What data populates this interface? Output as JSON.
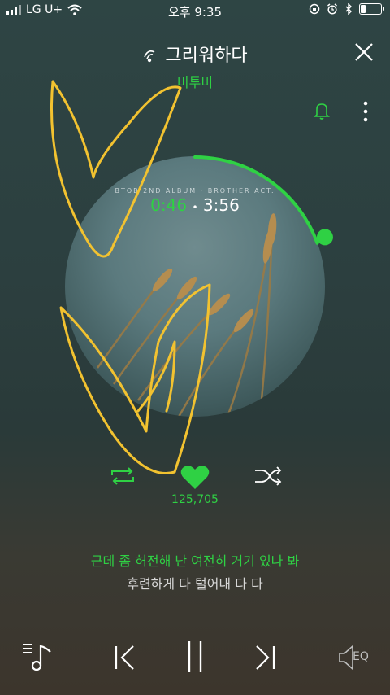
{
  "status_bar": {
    "carrier": "LG U+",
    "time": "오후 9:35",
    "battery_level": 0.25
  },
  "song": {
    "title": "그리워하다",
    "artist": "비투비"
  },
  "album": {
    "label": "BTOB 2ND ALBUM · BROTHER ACT."
  },
  "playback": {
    "current": "0:46",
    "separator": "•",
    "total": "3:56",
    "progress": 0.195
  },
  "likes": "125,705",
  "lyrics": {
    "current": "근데 좀 허전해 난 여전히 거기 있나 봐",
    "next": "후련하게 다 털어내 다 다"
  },
  "eq_label": "EQ",
  "colors": {
    "accent": "#2fd144",
    "annotation": "#f2c230"
  },
  "icons": [
    "wifi-icon",
    "screen-lock-icon",
    "alarm-icon",
    "bluetooth-icon",
    "battery-icon",
    "sound-wave-icon",
    "close-icon",
    "bell-icon",
    "more-vertical-icon",
    "repeat-icon",
    "heart-icon",
    "shuffle-icon",
    "playlist-icon",
    "previous-icon",
    "pause-icon",
    "next-icon",
    "eq-icon"
  ]
}
